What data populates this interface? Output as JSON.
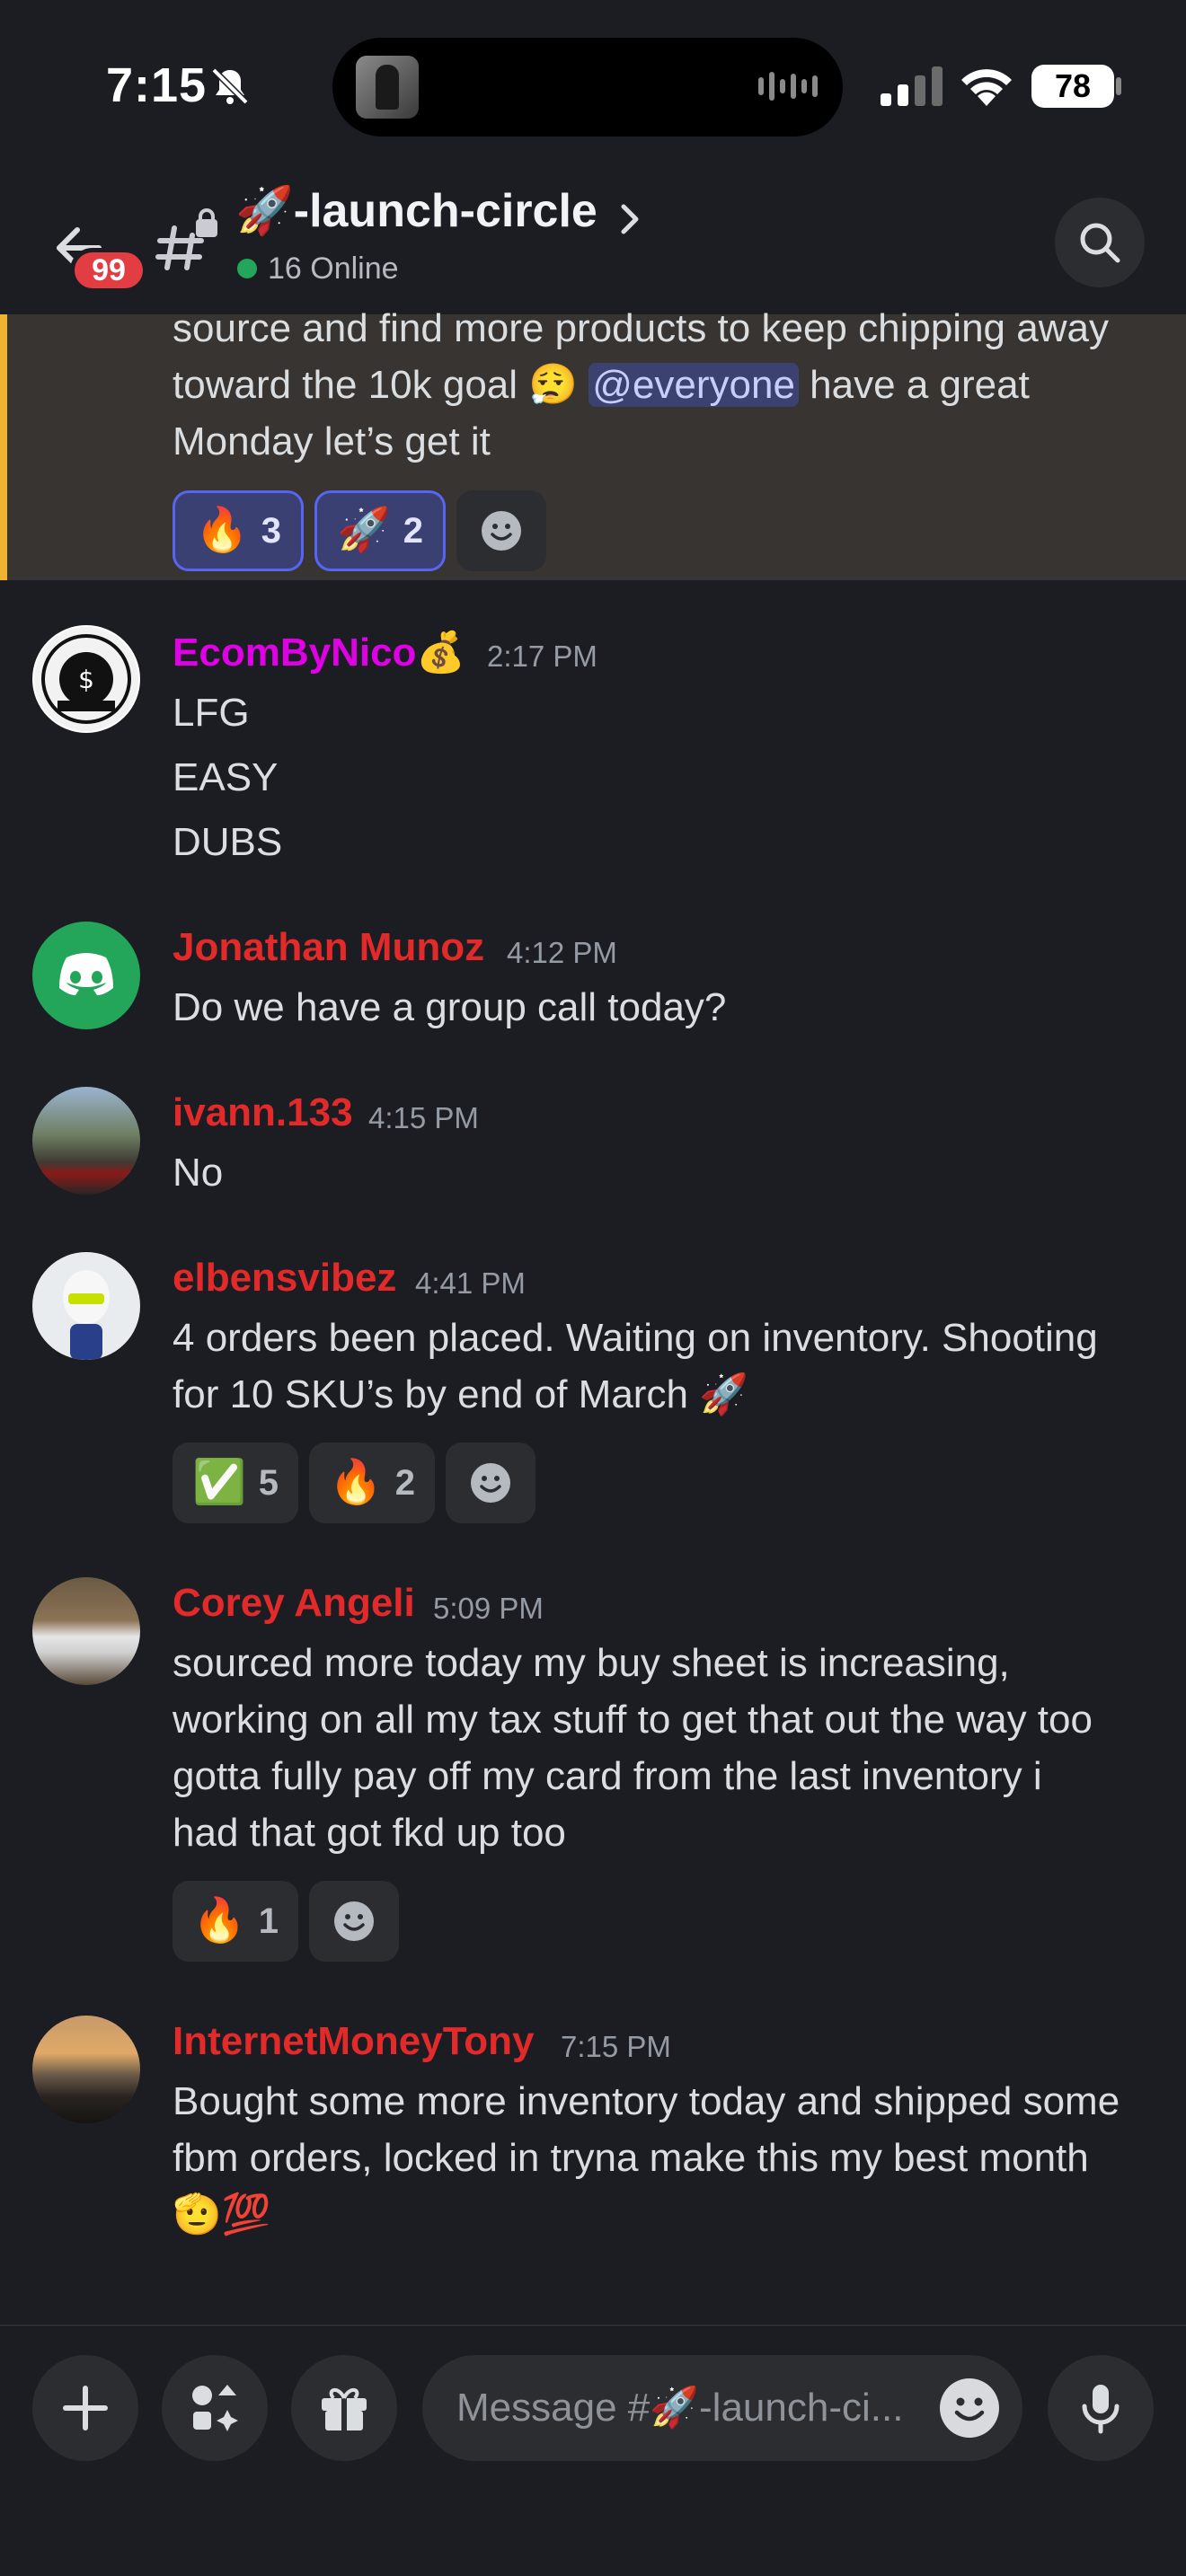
{
  "status_bar": {
    "time": "7:15",
    "battery": "78"
  },
  "header": {
    "unread_badge": "99",
    "channel_name": "🚀-launch-circle",
    "online_count": "16 Online"
  },
  "highlighted_message": {
    "line1": "source and find more products to keep chipping away",
    "line2_before": "toward the 10k goal 😮‍💨 ",
    "mention": "@everyone",
    "line2_after": " have a great",
    "line3": "Monday let’s get it",
    "reactions": [
      {
        "emoji": "🔥",
        "count": "3"
      },
      {
        "emoji": "🚀",
        "count": "2"
      }
    ]
  },
  "messages": [
    {
      "username": "EcomByNico💰",
      "color": "#e000e6",
      "time": "2:17 PM",
      "lines": [
        "LFG",
        "EASY",
        "DUBS"
      ]
    },
    {
      "username": "Jonathan Munoz",
      "color": "#e22a2a",
      "time": "4:12 PM",
      "lines": [
        "Do we have a group call today?"
      ]
    },
    {
      "username": "ivann.133",
      "color": "#e22a2a",
      "time": "4:15 PM",
      "lines": [
        "No"
      ]
    },
    {
      "username": "elbensvibez",
      "color": "#e22a2a",
      "time": "4:41 PM",
      "lines": [
        "4 orders been placed. Waiting on inventory. Shooting",
        "for 10 SKU’s by end of March 🚀"
      ],
      "reactions": [
        {
          "emoji": "✅",
          "count": "5"
        },
        {
          "emoji": "🔥",
          "count": "2"
        }
      ]
    },
    {
      "username": "Corey Angeli",
      "color": "#e22a2a",
      "time": "5:09 PM",
      "lines": [
        "sourced more today my buy sheet is increasing,",
        "working on all my tax stuff to get that out the way too",
        "gotta fully pay off my card from the last inventory i",
        "had that got fkd up too"
      ],
      "reactions": [
        {
          "emoji": "🔥",
          "count": "1"
        }
      ]
    },
    {
      "username": "InternetMoneyTony",
      "color": "#e22a2a",
      "time": "7:15 PM",
      "lines": [
        "Bought some more inventory today and shipped some",
        "fbm orders, locked in tryna make this my best month",
        "🫡💯"
      ]
    }
  ],
  "input": {
    "placeholder": "Message #🚀-launch-ci..."
  },
  "colors": {
    "background": "#1c1d22",
    "mention_bg": "#3c4270",
    "highlight_bar": "#f0b232",
    "online": "#23a55a"
  }
}
